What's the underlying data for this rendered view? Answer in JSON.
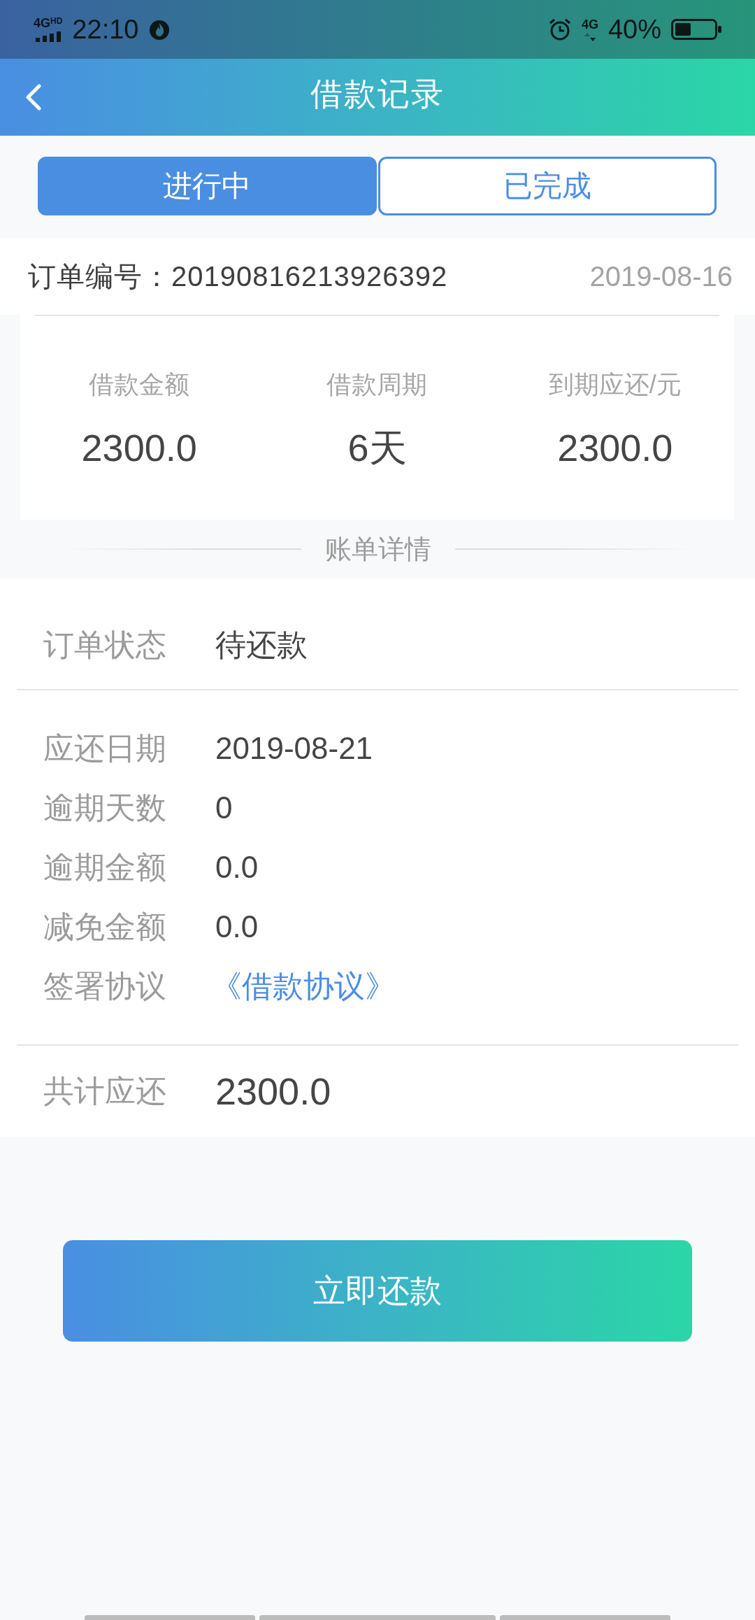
{
  "status_bar": {
    "network_left": "4G$^{HD}$",
    "time": "22:10",
    "network_right": "4G",
    "battery": "40%"
  },
  "header": {
    "title": "借款记录"
  },
  "tabs": [
    {
      "label": "进行中",
      "selected": true
    },
    {
      "label": "已完成",
      "selected": false
    }
  ],
  "order": {
    "number": "订单编号：20190816213926392",
    "date": "2019-08-16"
  },
  "summary": [
    {
      "label": "借款金额",
      "value": "2300.0"
    },
    {
      "label": "借款周期",
      "value": "6天"
    },
    {
      "label": "到期应还/元",
      "value": "2300.0"
    }
  ],
  "section_title": "账单详情",
  "status_row": {
    "label": "订单状态",
    "value": "待还款"
  },
  "details": [
    {
      "label": "应还日期",
      "value": "2019-08-21",
      "kind": "text"
    },
    {
      "label": "逾期天数",
      "value": "0",
      "kind": "text"
    },
    {
      "label": "逾期金额",
      "value": "0.0",
      "kind": "text"
    },
    {
      "label": "减免金额",
      "value": "0.0",
      "kind": "text"
    },
    {
      "label": "签署协议",
      "value": "《借款协议》",
      "kind": "link"
    }
  ],
  "total": {
    "label": "共计应还",
    "value": "2300.0"
  },
  "button": {
    "label": "立即还款"
  }
}
